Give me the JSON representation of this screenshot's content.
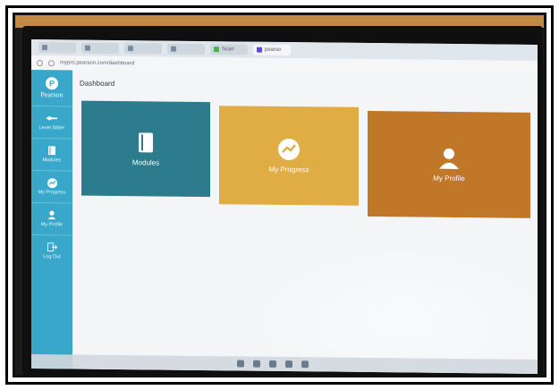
{
  "browser": {
    "url": "mypro.pearson.com/dashboard",
    "tabs": [
      {
        "label": ""
      },
      {
        "label": ""
      },
      {
        "label": ""
      },
      {
        "label": ""
      },
      {
        "label": "Scan"
      },
      {
        "label": "pearso"
      }
    ]
  },
  "sidebar": {
    "brand": "Pearson",
    "items": [
      {
        "label": "Level Slider",
        "icon": "slider-icon"
      },
      {
        "label": "Modules",
        "icon": "book-icon"
      },
      {
        "label": "My Progress",
        "icon": "progress-icon"
      },
      {
        "label": "My Profile",
        "icon": "user-icon"
      },
      {
        "label": "Log Out",
        "icon": "logout-icon"
      }
    ]
  },
  "main": {
    "title": "Dashboard",
    "tiles": [
      {
        "label": "Modules",
        "icon": "book-icon",
        "color": "#2c7c8e"
      },
      {
        "label": "My Progress",
        "icon": "progress-icon",
        "color": "#e0ad44"
      },
      {
        "label": "My Profile",
        "icon": "user-icon",
        "color": "#c07728"
      }
    ]
  },
  "colors": {
    "sidebar": "#39a7c9",
    "background": "#f3f5f7"
  }
}
